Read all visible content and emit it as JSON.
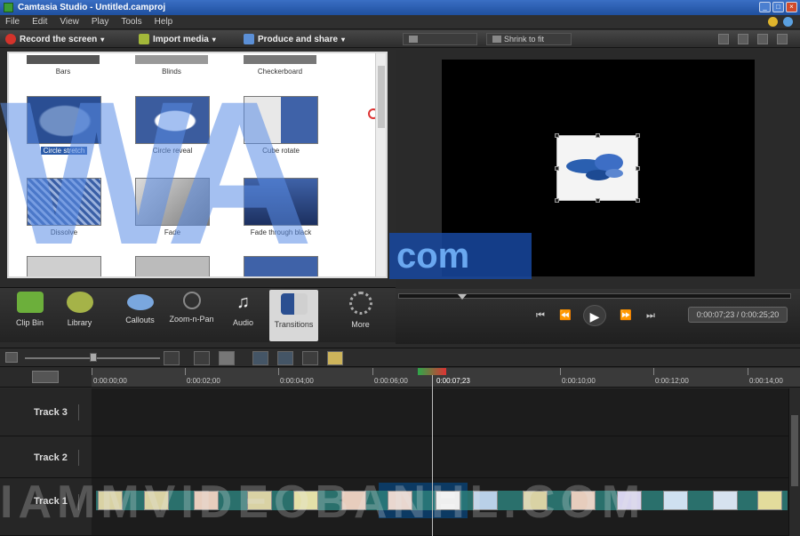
{
  "window": {
    "title": "Camtasia Studio - Untitled.camproj"
  },
  "menu": [
    "File",
    "Edit",
    "View",
    "Play",
    "Tools",
    "Help"
  ],
  "toolbar": {
    "record": "Record the screen",
    "import": "Import media",
    "produce": "Produce and share",
    "view_btn1": "",
    "view_btn2": "Shrink to fit"
  },
  "transitions": {
    "top_row": [
      "Bars",
      "Blinds",
      "Checkerboard"
    ],
    "items": [
      {
        "label": "Circle stretch",
        "selected": true
      },
      {
        "label": "Circle reveal",
        "selected": false
      },
      {
        "label": "Cube rotate",
        "selected": false
      },
      {
        "label": "Dissolve",
        "selected": false
      },
      {
        "label": "Fade",
        "selected": false
      },
      {
        "label": "Fade through black",
        "selected": false
      }
    ]
  },
  "tasks": [
    {
      "label": "Clip Bin",
      "icon": "clip-bin-icon"
    },
    {
      "label": "Library",
      "icon": "library-icon"
    },
    {
      "label": "Callouts",
      "icon": "callouts-icon"
    },
    {
      "label": "Zoom-n-Pan",
      "icon": "zoom-n-pan-icon"
    },
    {
      "label": "Audio",
      "icon": "audio-icon"
    },
    {
      "label": "Transitions",
      "icon": "transitions-icon"
    },
    {
      "label": "More",
      "icon": "more-icon"
    }
  ],
  "playback": {
    "time": "0:00:07;23 / 0:00:25;20"
  },
  "timeline": {
    "ticks": [
      "0:00:00;00",
      "0:00:02;00",
      "0:00:04;00",
      "0:00:06;00",
      "0:00:08;00",
      "0:00:10;00",
      "0:00:12;00",
      "0:00:14;00"
    ],
    "playhead_label": "0:00:07;23",
    "tracks": [
      "Track 3",
      "Track 2",
      "Track 1"
    ]
  },
  "watermark": {
    "big": "WA",
    "com": "com",
    "bottom": "IAMMVIDEOBANHL.COM"
  }
}
